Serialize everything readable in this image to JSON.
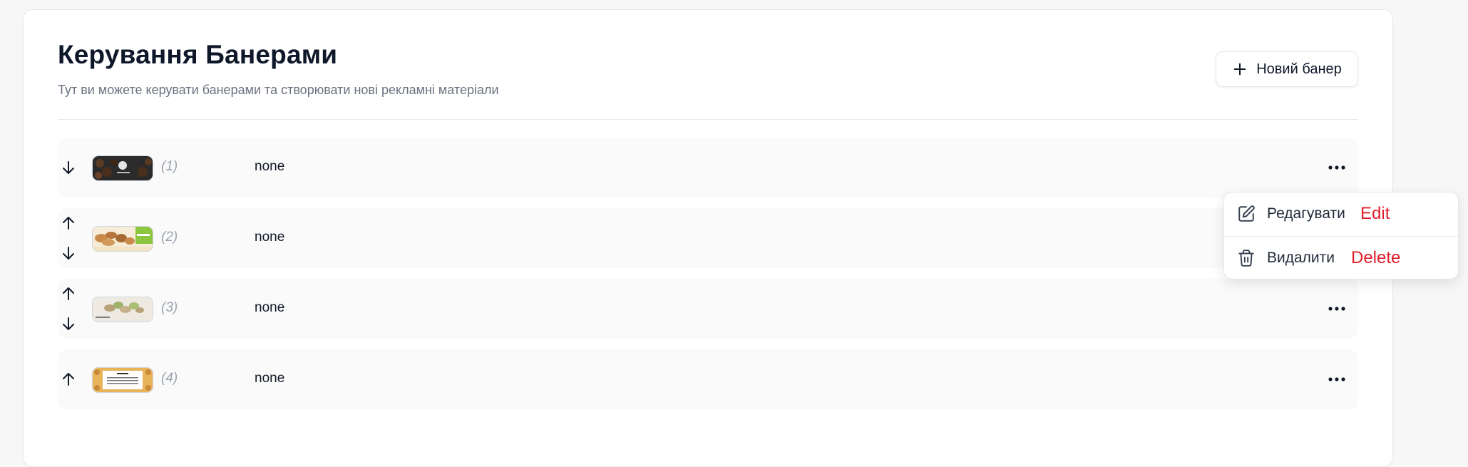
{
  "header": {
    "title": "Керування Банерами",
    "subtitle": "Тут ви можете керувати банерами та створювати нові рекламні матеріали",
    "new_button_label": "Новий банер"
  },
  "banners": [
    {
      "index": "(1)",
      "name": "none",
      "arrows": [
        "down"
      ]
    },
    {
      "index": "(2)",
      "name": "none",
      "arrows": [
        "up",
        "down"
      ]
    },
    {
      "index": "(3)",
      "name": "none",
      "arrows": [
        "up",
        "down"
      ]
    },
    {
      "index": "(4)",
      "name": "none",
      "arrows": [
        "up"
      ]
    }
  ],
  "context_menu": {
    "edit_label": "Редагувати",
    "edit_note": "Edit",
    "delete_label": "Видалити",
    "delete_note": "Delete"
  },
  "colors": {
    "accent_annotation": "#e11d2a",
    "row_background": "#fafafa",
    "muted_text": "#6b7280"
  },
  "icons": [
    "plus-icon",
    "arrow-up-icon",
    "arrow-down-icon",
    "more-horizontal-icon",
    "pencil-icon",
    "trash-icon"
  ]
}
